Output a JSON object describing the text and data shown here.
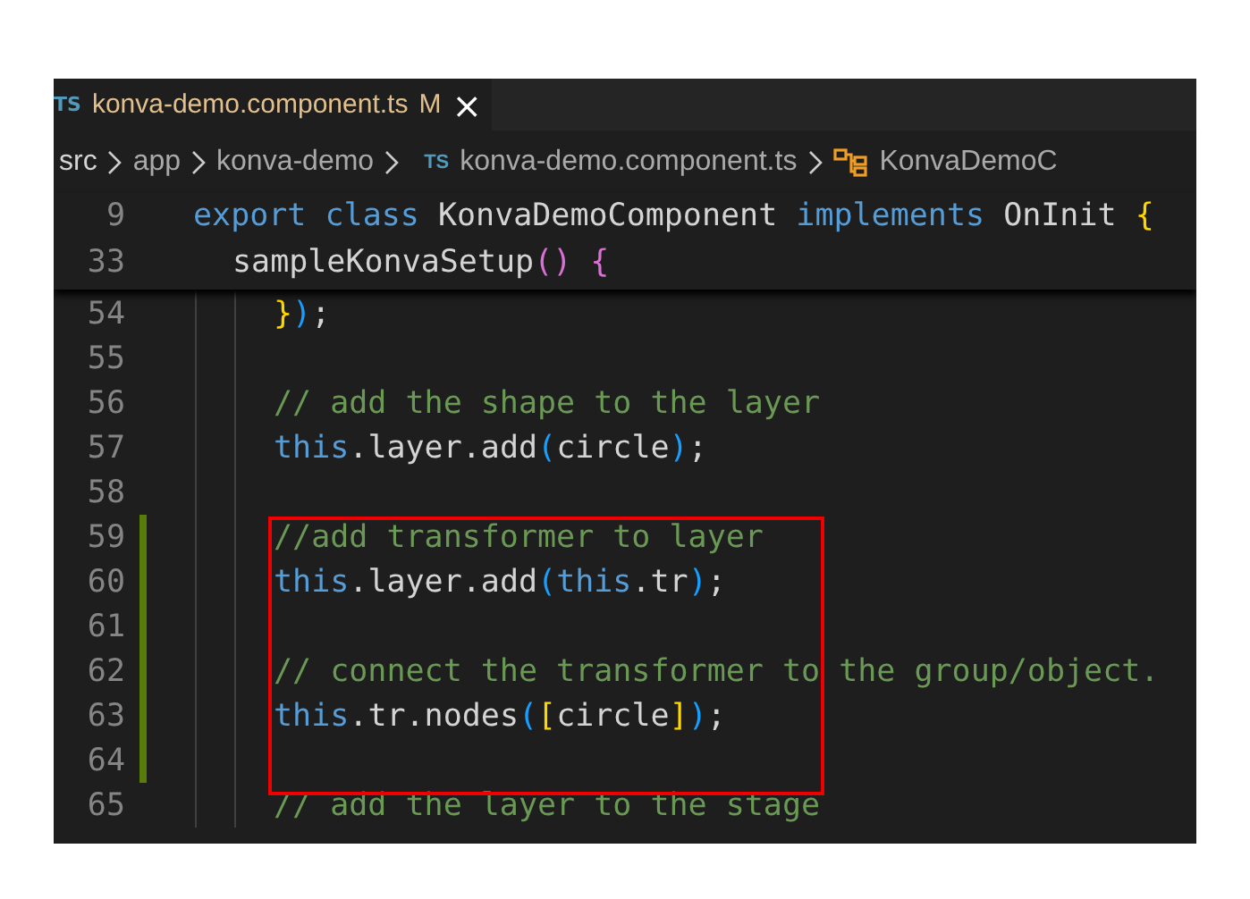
{
  "tab": {
    "badge": "TS",
    "title": "konva-demo.component.ts",
    "status": "M",
    "close": "×",
    "modified": true
  },
  "breadcrumbs": [
    {
      "kind": "folder",
      "label": "src"
    },
    {
      "kind": "folder",
      "label": "app"
    },
    {
      "kind": "folder",
      "label": "konva-demo"
    },
    {
      "kind": "file",
      "badge": "TS",
      "label": "konva-demo.component.ts"
    },
    {
      "kind": "class",
      "label": "KonvaDemoC"
    }
  ],
  "sticky_scroll": [
    {
      "number": "9",
      "tokens": [
        {
          "kind": "keyword",
          "text": "export class "
        },
        {
          "kind": "plain",
          "text": "KonvaDemoComponent "
        },
        {
          "kind": "keyword",
          "text": "implements "
        },
        {
          "kind": "plain",
          "text": "OnInit "
        },
        {
          "kind": "bracket1",
          "text": "{"
        }
      ],
      "children": [
        {
          "number": "33",
          "tokens": [
            {
              "kind": "plain",
              "text": "sampleKonvaSetup"
            },
            {
              "kind": "bracket2",
              "text": "() {"
            }
          ]
        }
      ]
    }
  ],
  "lines": [
    {
      "number": "54",
      "modified": false,
      "tokens": [
        {
          "kind": "bracket1",
          "text": "}"
        },
        {
          "kind": "bracket3",
          "text": ")"
        },
        {
          "kind": "plain",
          "text": ";"
        }
      ]
    },
    {
      "number": "55",
      "modified": false
    },
    {
      "number": "56",
      "modified": false,
      "tokens": [
        {
          "kind": "comment",
          "text": "// add the shape to the layer"
        }
      ]
    },
    {
      "number": "57",
      "modified": false,
      "tokens": [
        {
          "kind": "keyword",
          "text": "this"
        },
        {
          "kind": "plain",
          "text": ".layer.add"
        },
        {
          "kind": "bracket3",
          "text": "("
        },
        {
          "kind": "plain",
          "text": "circle"
        },
        {
          "kind": "bracket3",
          "text": ")"
        },
        {
          "kind": "plain",
          "text": ";"
        }
      ]
    },
    {
      "number": "58",
      "modified": false
    },
    {
      "number": "59",
      "modified": true,
      "tokens": [
        {
          "kind": "comment",
          "text": "//add transformer to layer"
        }
      ]
    },
    {
      "number": "60",
      "modified": true,
      "tokens": [
        {
          "kind": "keyword",
          "text": "this"
        },
        {
          "kind": "plain",
          "text": ".layer.add"
        },
        {
          "kind": "bracket3",
          "text": "("
        },
        {
          "kind": "keyword",
          "text": "this"
        },
        {
          "kind": "plain",
          "text": ".tr"
        },
        {
          "kind": "bracket3",
          "text": ")"
        },
        {
          "kind": "plain",
          "text": ";"
        }
      ]
    },
    {
      "number": "61",
      "modified": true
    },
    {
      "number": "62",
      "modified": true,
      "tokens": [
        {
          "kind": "comment",
          "text": "// connect the transformer to the group/object."
        }
      ]
    },
    {
      "number": "63",
      "modified": true,
      "tokens": [
        {
          "kind": "keyword",
          "text": "this"
        },
        {
          "kind": "plain",
          "text": ".tr.nodes"
        },
        {
          "kind": "bracket3",
          "text": "("
        },
        {
          "kind": "bracket1",
          "text": "["
        },
        {
          "kind": "plain",
          "text": "circle"
        },
        {
          "kind": "bracket1",
          "text": "]"
        },
        {
          "kind": "bracket3",
          "text": ")"
        },
        {
          "kind": "plain",
          "text": ";"
        }
      ]
    },
    {
      "number": "64",
      "modified": true
    },
    {
      "number": "65",
      "modified": false,
      "tokens": [
        {
          "kind": "comment",
          "text": "// add the layer to the stage"
        }
      ]
    }
  ]
}
